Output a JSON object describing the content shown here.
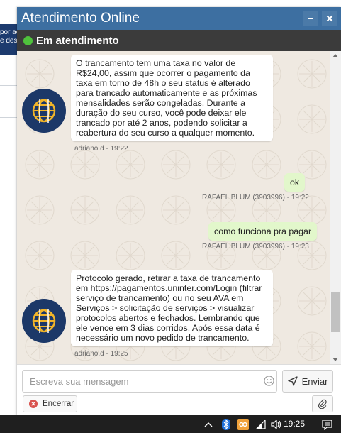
{
  "background": {
    "banner_text_line1": "por ac",
    "banner_text_line2": "e dess"
  },
  "window": {
    "title": "Atendimento Online",
    "minimize_label": "–",
    "close_label": "×",
    "status": "Em atendimento",
    "status_color": "#4fc23c",
    "title_color": "#3d6fa1"
  },
  "messages": [
    {
      "direction": "incoming",
      "text_lines": [
        "O trancamento tem uma taxa no valor de",
        "R$24,00, assim que ocorrer o pagamento da",
        "taxa em torno de 48h o seu status é alterado",
        "para trancado automaticamente e as próximas",
        "mensalidades serão congeladas. Durante a",
        "duração do seu curso, você pode deixar ele",
        "trancado por até 2 anos, podendo solicitar a",
        "reabertura do seu curso a qualquer momento."
      ],
      "meta": "adriano.d - 19:22"
    },
    {
      "direction": "outgoing",
      "text": "ok",
      "meta": "RAFAEL BLUM (3903996) - 19:22"
    },
    {
      "direction": "outgoing",
      "text": "como funciona pra pagar",
      "meta": "RAFAEL BLUM (3903996) - 19:23"
    },
    {
      "direction": "incoming",
      "text_lines": [
        "Protocolo gerado, retirar a taxa de trancamento",
        "em https://pagamentos.uninter.com/Login (filtrar",
        "serviço de trancamento) ou no seu AVA em",
        "Serviços > solicitação de serviços > visualizar",
        "protocolos abertos e fechados. Lembrando que",
        "ele vence em 3 dias corridos. Após essa data é",
        "necessário um novo pedido de trancamento."
      ],
      "meta": "adriano.d - 19:25"
    }
  ],
  "composer": {
    "placeholder": "Escreva sua mensagem",
    "send_label": "Enviar",
    "close_label": "Encerrar",
    "emoji_icon": "smiley-icon",
    "attach_icon": "paperclip-icon"
  },
  "taskbar": {
    "time": "19:25",
    "icons": [
      "chevron-up-icon",
      "bluetooth-icon",
      "app-icon",
      "wifi-icon",
      "volume-icon",
      "notification-icon"
    ]
  }
}
